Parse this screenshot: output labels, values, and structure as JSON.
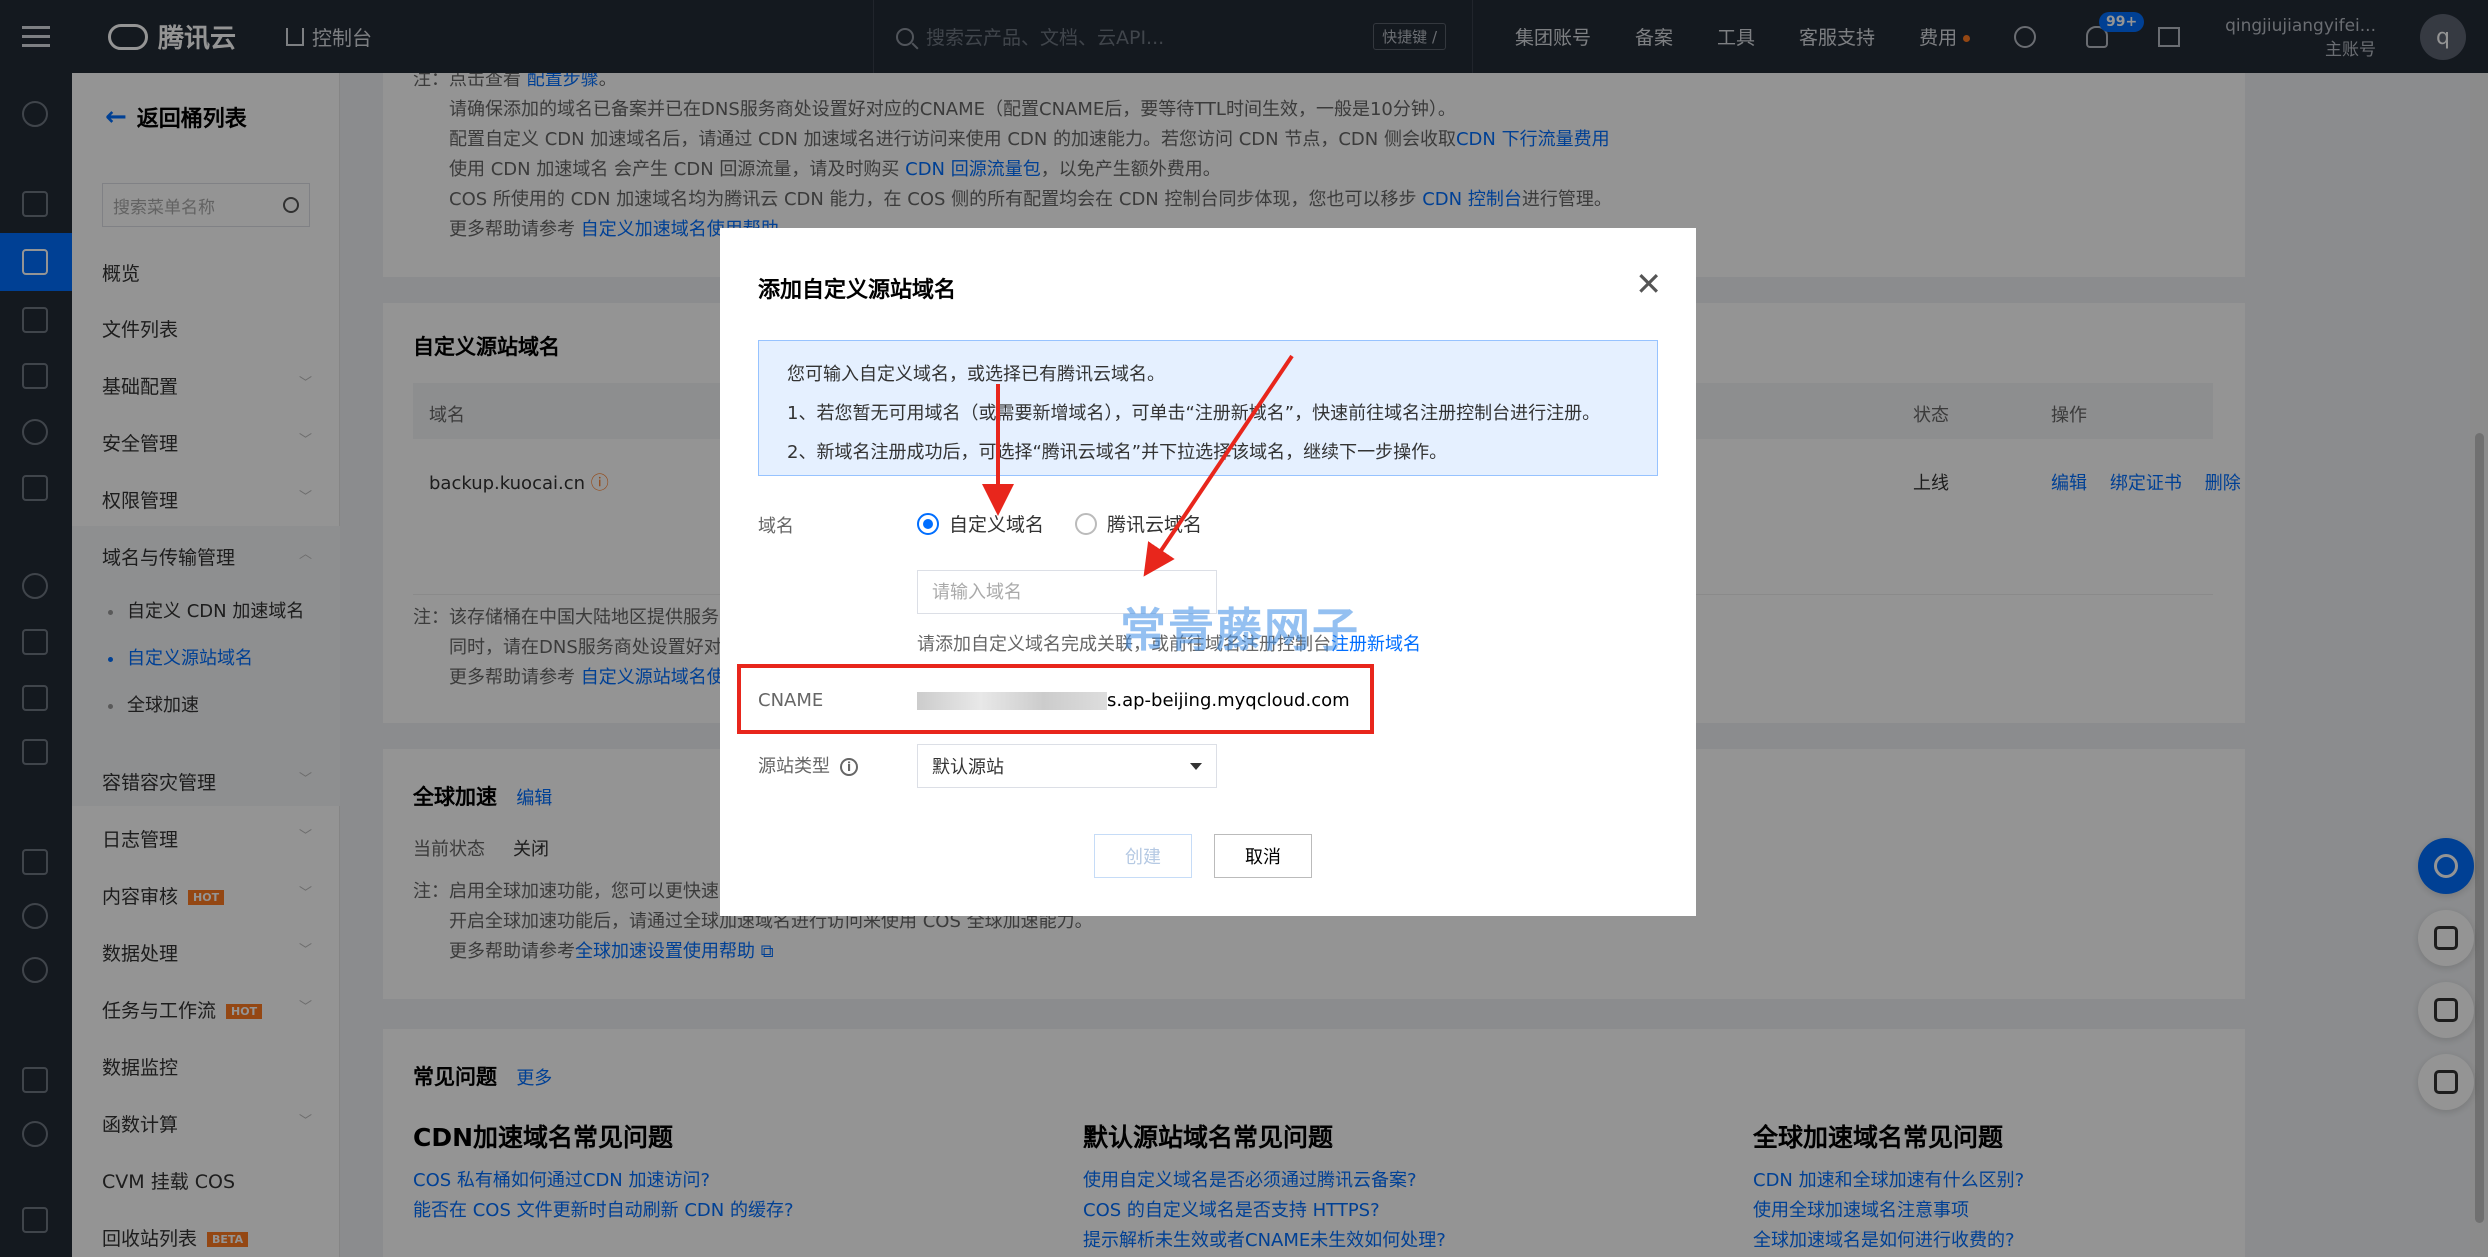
{
  "topbar": {
    "brand": "腾讯云",
    "console": "控制台",
    "search_placeholder": "搜索云产品、文档、云API...",
    "shortcut": "快捷键 /",
    "nav": [
      "集团账号",
      "备案",
      "工具",
      "客服支持",
      "费用"
    ],
    "notif_badge": "99+",
    "user_name": "qingjiujiangyifei...",
    "user_role": "主账号",
    "avatar": "q"
  },
  "sidemenu": {
    "back": "返回桶列表",
    "search_placeholder": "搜索菜单名称",
    "items": [
      {
        "label": "概览"
      },
      {
        "label": "文件列表"
      },
      {
        "label": "基础配置"
      },
      {
        "label": "安全管理"
      },
      {
        "label": "权限管理"
      },
      {
        "label": "域名与传输管理"
      }
    ],
    "subitems": [
      "自定义 CDN 加速域名",
      "自定义源站域名",
      "全球加速"
    ],
    "items2": [
      {
        "label": "容错容灾管理"
      },
      {
        "label": "日志管理"
      },
      {
        "label": "内容审核",
        "tag": "HOT"
      },
      {
        "label": "数据处理"
      },
      {
        "label": "任务与工作流",
        "tag": "HOT"
      },
      {
        "label": "数据监控"
      },
      {
        "label": "函数计算"
      },
      {
        "label": "CVM 挂载 COS"
      },
      {
        "label": "回收站列表",
        "tag": "BETA"
      }
    ]
  },
  "main": {
    "top_notes": {
      "line0_pre": "注：点击查看 ",
      "line0_link": "配置步骤",
      "line0_post": "。",
      "line1": "请确保添加的域名已备案并已在DNS服务商处设置好对应的CNAME（配置CNAME后，要等待TTL时间生效，一般是10分钟）。",
      "line2_pre": "配置自定义 CDN 加速域名后，请通过 CDN 加速域名进行访问来使用 CDN 的加速能力。若您访问 CDN 节点，CDN 侧会收取",
      "line2_link": "CDN 下行流量费用",
      "line3_pre": "使用 CDN 加速域名 会产生 CDN 回源流量，请及时购买 ",
      "line3_link": "CDN 回源流量包",
      "line3_post": "，以免产生额外费用。",
      "line4_pre": "COS 所使用的 CDN 加速域名均为腾讯云 CDN 能力，在 COS 侧的所有配置均会在 CDN 控制台同步体现，您也可以移步 ",
      "line4_link": "CDN 控制台",
      "line4_post": "进行管理。",
      "line5_pre": "更多帮助请参考 ",
      "line5_link": "自定义加速域名使用帮助"
    },
    "origin_section": {
      "title": "自定义源站域名",
      "col_domain": "域名",
      "col_status": "状态",
      "col_action": "操作",
      "row_domain": "backup.kuocai.cn",
      "row_status": "上线",
      "row_actions": [
        "编辑",
        "绑定证书",
        "删除"
      ],
      "note1": "注：该存储桶在中国大陆地区提供服务",
      "note2": "同时，请在DNS服务商处设置好对",
      "note3_pre": "更多帮助请参考 ",
      "note3_link": "自定义源站域名使"
    },
    "global_section": {
      "title": "全球加速",
      "edit": "编辑",
      "status_label": "当前状态",
      "status_value": "关闭",
      "note1": "注：启用全球加速功能，您可以更快速",
      "note2": "开启全球加速功能后，请通过全球加速域名进行访问来使用 COS 全球加速能力。",
      "note3_pre": "更多帮助请参考",
      "note3_link": "全球加速设置使用帮助"
    },
    "faq": {
      "title": "常见问题",
      "more": "更多",
      "cols": [
        {
          "title": "CDN加速域名常见问题",
          "links": [
            "COS 私有桶如何通过CDN 加速访问?",
            "能否在 COS 文件更新时自动刷新 CDN 的缓存?"
          ]
        },
        {
          "title": "默认源站域名常见问题",
          "links": [
            "使用自定义域名是否必须通过腾讯云备案?",
            "COS 的自定义域名是否支持 HTTPS?",
            "提示解析未生效或者CNAME未生效如何处理?"
          ]
        },
        {
          "title": "全球加速域名常见问题",
          "links": [
            "CDN 加速和全球加速有什么区别?",
            "使用全球加速域名注意事项",
            "全球加速域名是如何进行收费的?"
          ]
        }
      ]
    }
  },
  "dialog": {
    "title": "添加自定义源站域名",
    "info_line1": "您可输入自定义域名，或选择已有腾讯云域名。",
    "info_line2": "1、若您暂无可用域名（或需要新增域名），可单击“注册新域名”，快速前往域名注册控制台进行注册。",
    "info_line3": "2、新域名注册成功后，可选择“腾讯云域名”并下拉选择该域名，继续下一步操作。",
    "domain_label": "域名",
    "radio_custom": "自定义域名",
    "radio_tencent": "腾讯云域名",
    "input_placeholder": "请输入域名",
    "hint_pre": "请添加自定义域名完成关联，或前往域名注册控制台",
    "hint_link": "注册新域名",
    "cname_label": "CNAME",
    "cname_value": "s.ap-beijing.myqcloud.com",
    "origin_type_label": "源站类型",
    "origin_type_value": "默认源站",
    "create_button": "创建",
    "cancel_button": "取消",
    "watermark": "常青藤网子"
  },
  "colors": {
    "accent": "#006eff",
    "topbar": "#242b36",
    "annotation_red": "#e8261c",
    "hot_tag": "#ff7a22"
  }
}
